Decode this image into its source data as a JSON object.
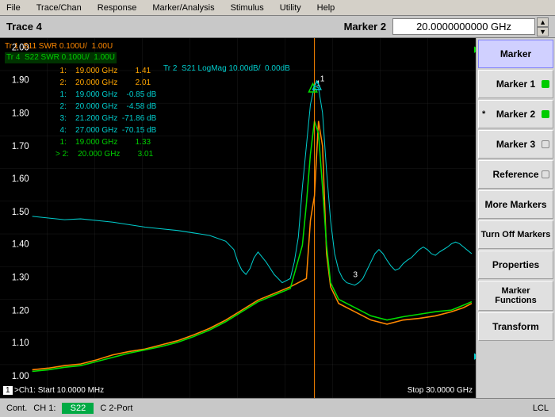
{
  "menubar": {
    "items": [
      "File",
      "Trace/Chan",
      "Response",
      "Marker/Analysis",
      "Stimulus",
      "Utility",
      "Help"
    ]
  },
  "titlebar": {
    "trace_label": "Trace 4",
    "marker_label": "Marker 2",
    "marker_value": "20.0000000000 GHz"
  },
  "chart": {
    "y_labels": [
      "2.00",
      "1.90",
      "1.80",
      "1.70",
      "1.60",
      "1.50",
      "1.40",
      "1.30",
      "1.20",
      "1.10",
      "1.00"
    ],
    "trace_labels": [
      {
        "text": "Tr 1  S11 SWR 0.100U/  1.00U",
        "color": "#ff8800"
      },
      {
        "text": "Tr 4  S22 SWR 0.100U/  1.00U",
        "color": "#00cc00"
      },
      {
        "text": "Tr 2  S21 LogMag 10.00dB/  0.00dB",
        "color": "#00cccc"
      }
    ],
    "marker_readouts": [
      {
        "prefix": "1:",
        "freq": "19.000 GHz",
        "value": "1.41",
        "color": "orange"
      },
      {
        "prefix": "2:",
        "freq": "20.000 GHz",
        "value": "2.01",
        "color": "orange"
      },
      {
        "prefix": "1:",
        "freq": "19.000 GHz",
        "value": "-0.85 dB",
        "color": "cyan"
      },
      {
        "prefix": "2:",
        "freq": "20.000 GHz",
        "value": "-4.58 dB",
        "color": "cyan"
      },
      {
        "prefix": "3:",
        "freq": "21.200 GHz",
        "value": "-71.86 dB",
        "color": "cyan"
      },
      {
        "prefix": "4:",
        "freq": "27.000 GHz",
        "value": "-70.15 dB",
        "color": "cyan"
      },
      {
        "prefix": "1:",
        "freq": "19.000 GHz",
        "value": "1.33",
        "color": "green"
      },
      {
        "prefix": "> 2:",
        "freq": "20.000 GHz",
        "value": "3.01",
        "color": "green"
      }
    ],
    "start_freq": ">Ch1: Start  10.0000 MHz",
    "stop_freq": "Stop  30.0000 GHz",
    "chart_number": "1"
  },
  "bottom_bar": {
    "cont": "Cont.",
    "ch1": "CH 1:",
    "param": "S22",
    "mode": "C 2-Port",
    "lcl": "LCL"
  },
  "right_panel": {
    "buttons": [
      {
        "label": "Marker",
        "active": true,
        "dot": null,
        "star": null
      },
      {
        "label": "Marker 1",
        "active": false,
        "dot": "green",
        "star": null
      },
      {
        "label": "Marker 2",
        "active": false,
        "dot": "green",
        "star": "*"
      },
      {
        "label": "Marker 3",
        "active": false,
        "dot": "white",
        "star": null
      },
      {
        "label": "Reference",
        "active": false,
        "dot": "white",
        "star": null
      },
      {
        "label": "More Markers",
        "active": false,
        "dot": null,
        "star": null
      },
      {
        "label": "Turn Off Markers",
        "active": false,
        "dot": null,
        "star": null
      },
      {
        "label": "Properties",
        "active": false,
        "dot": null,
        "star": null
      },
      {
        "label": "Marker Functions",
        "active": false,
        "dot": null,
        "star": null
      },
      {
        "label": "Transform",
        "active": false,
        "dot": null,
        "star": null
      }
    ]
  }
}
